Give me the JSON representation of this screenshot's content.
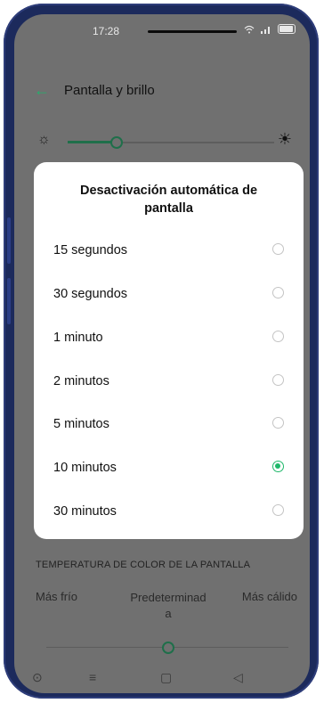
{
  "status_bar": {
    "time": "17:28",
    "icons": [
      "wifi-icon",
      "signal-icon",
      "battery-icon"
    ]
  },
  "header": {
    "back_icon": "back-arrow-icon",
    "title": "Pantalla y brillo",
    "accent_color": "#23b06b"
  },
  "brightness": {
    "level": 0.22,
    "low_icon": "sun-small-icon",
    "high_icon": "sun-large-icon"
  },
  "dialog": {
    "title": "Desactivación automática de pantalla",
    "options": [
      {
        "label": "15 segundos",
        "selected": false
      },
      {
        "label": "30 segundos",
        "selected": false
      },
      {
        "label": "1 minuto",
        "selected": false
      },
      {
        "label": "2 minutos",
        "selected": false
      },
      {
        "label": "5 minutos",
        "selected": false
      },
      {
        "label": "10 minutos",
        "selected": true
      },
      {
        "label": "30 minutos",
        "selected": false
      }
    ],
    "selected_color": "#1fb86a"
  },
  "color_temperature": {
    "title": "TEMPERATURA DE COLOR DE LA PANTALLA",
    "cold_label": "Más frío",
    "default_label": "Predeterminad a",
    "warm_label": "Más cálido",
    "level": 0.5
  },
  "navbar": {
    "items": [
      "accessibility-icon",
      "menu-icon",
      "home-icon",
      "back-icon"
    ]
  }
}
